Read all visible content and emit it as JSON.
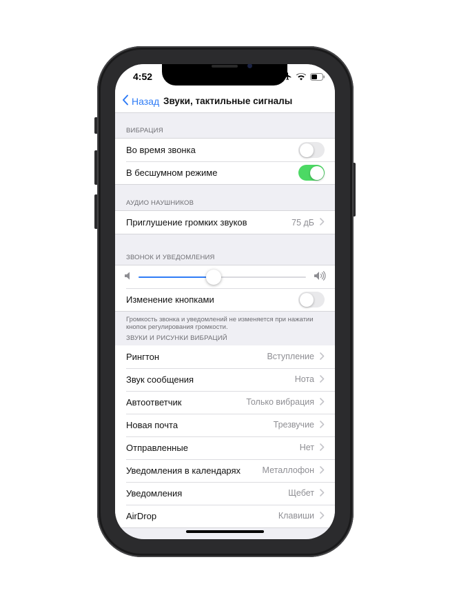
{
  "status": {
    "time": "4:52"
  },
  "nav": {
    "back_label": "Назад",
    "title": "Звуки, тактильные сигналы"
  },
  "sections": {
    "vibration": {
      "header": "ВИБРАЦИЯ",
      "rows": [
        {
          "label": "Во время звонка",
          "on": false
        },
        {
          "label": "В бесшумном режиме",
          "on": true
        }
      ]
    },
    "headphone": {
      "header": "АУДИО НАУШНИКОВ",
      "row": {
        "label": "Приглушение громких звуков",
        "value": "75 дБ"
      }
    },
    "ringer": {
      "header": "ЗВОНОК И УВЕДОМЛЕНИЯ",
      "volume_fraction": 0.45,
      "change_with_buttons": {
        "label": "Изменение кнопками",
        "on": false
      },
      "footnote": "Громкость звонка и уведомлений не изменяется при нажатии кнопок регулирования громкости."
    },
    "sounds": {
      "header": "ЗВУКИ И РИСУНКИ ВИБРАЦИЙ",
      "rows": [
        {
          "label": "Рингтон",
          "value": "Вступление"
        },
        {
          "label": "Звук сообщения",
          "value": "Нота"
        },
        {
          "label": "Автоответчик",
          "value": "Только вибрация"
        },
        {
          "label": "Новая почта",
          "value": "Трезвучие"
        },
        {
          "label": "Отправленные",
          "value": "Нет"
        },
        {
          "label": "Уведомления в календарях",
          "value": "Металлофон"
        },
        {
          "label": "Уведомления",
          "value": "Щебет"
        },
        {
          "label": "AirDrop",
          "value": "Клавиши"
        }
      ]
    }
  },
  "colors": {
    "accent": "#2f7cf6",
    "switch_on": "#4cd964",
    "background": "#efeff4"
  },
  "icons": [
    "airplane-icon",
    "wifi-icon",
    "battery-icon",
    "chevron-left-icon",
    "chevron-right-icon",
    "speaker-low-icon",
    "speaker-high-icon"
  ]
}
